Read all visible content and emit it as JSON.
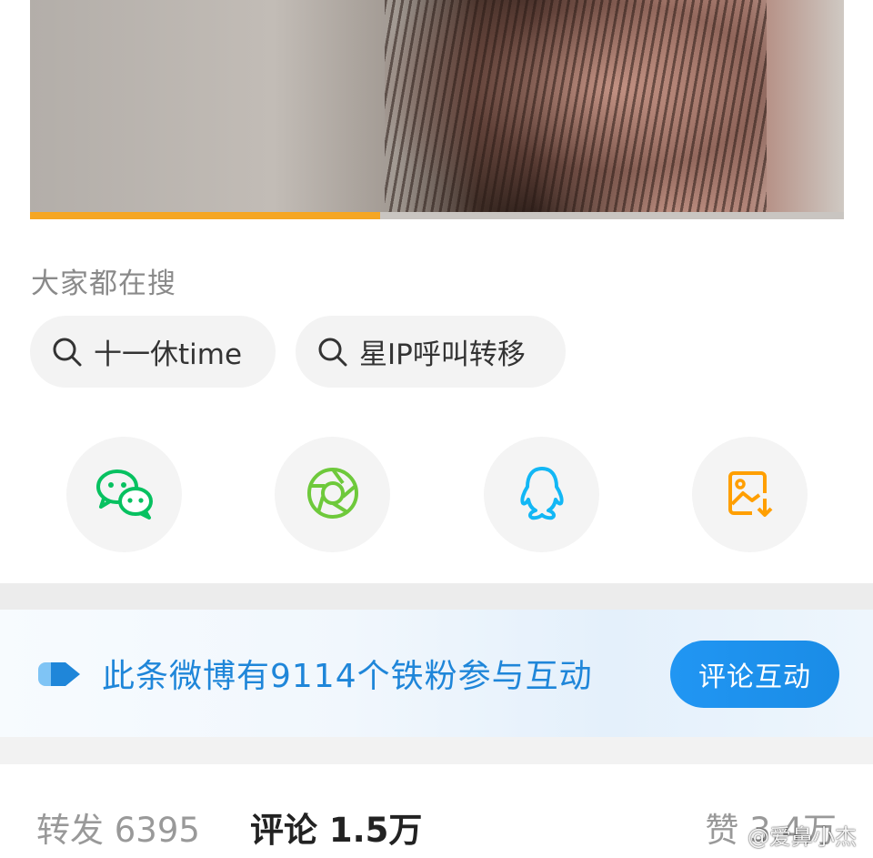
{
  "video": {
    "progress": 0.43
  },
  "search_section": {
    "title": "大家都在搜",
    "chips": [
      {
        "label": "十一休time",
        "icon": "search-icon"
      },
      {
        "label": "星IP呼叫转移",
        "icon": "search-icon"
      }
    ]
  },
  "share": {
    "items": [
      {
        "icon": "wechat-icon",
        "color": "#07c160"
      },
      {
        "icon": "moments-icon",
        "color": "#6ec93b"
      },
      {
        "icon": "qq-icon",
        "color": "#12b7f5"
      },
      {
        "icon": "save-image-icon",
        "color": "#ff9f00"
      }
    ]
  },
  "fan_banner": {
    "text": "此条微博有9114个铁粉参与互动",
    "button": "评论互动",
    "accent": "#1f86d9"
  },
  "stats": {
    "forward": "转发 6395",
    "comment": "评论 1.5万",
    "like": "赞 3.4万"
  },
  "watermark": "@爱鼻小杰"
}
